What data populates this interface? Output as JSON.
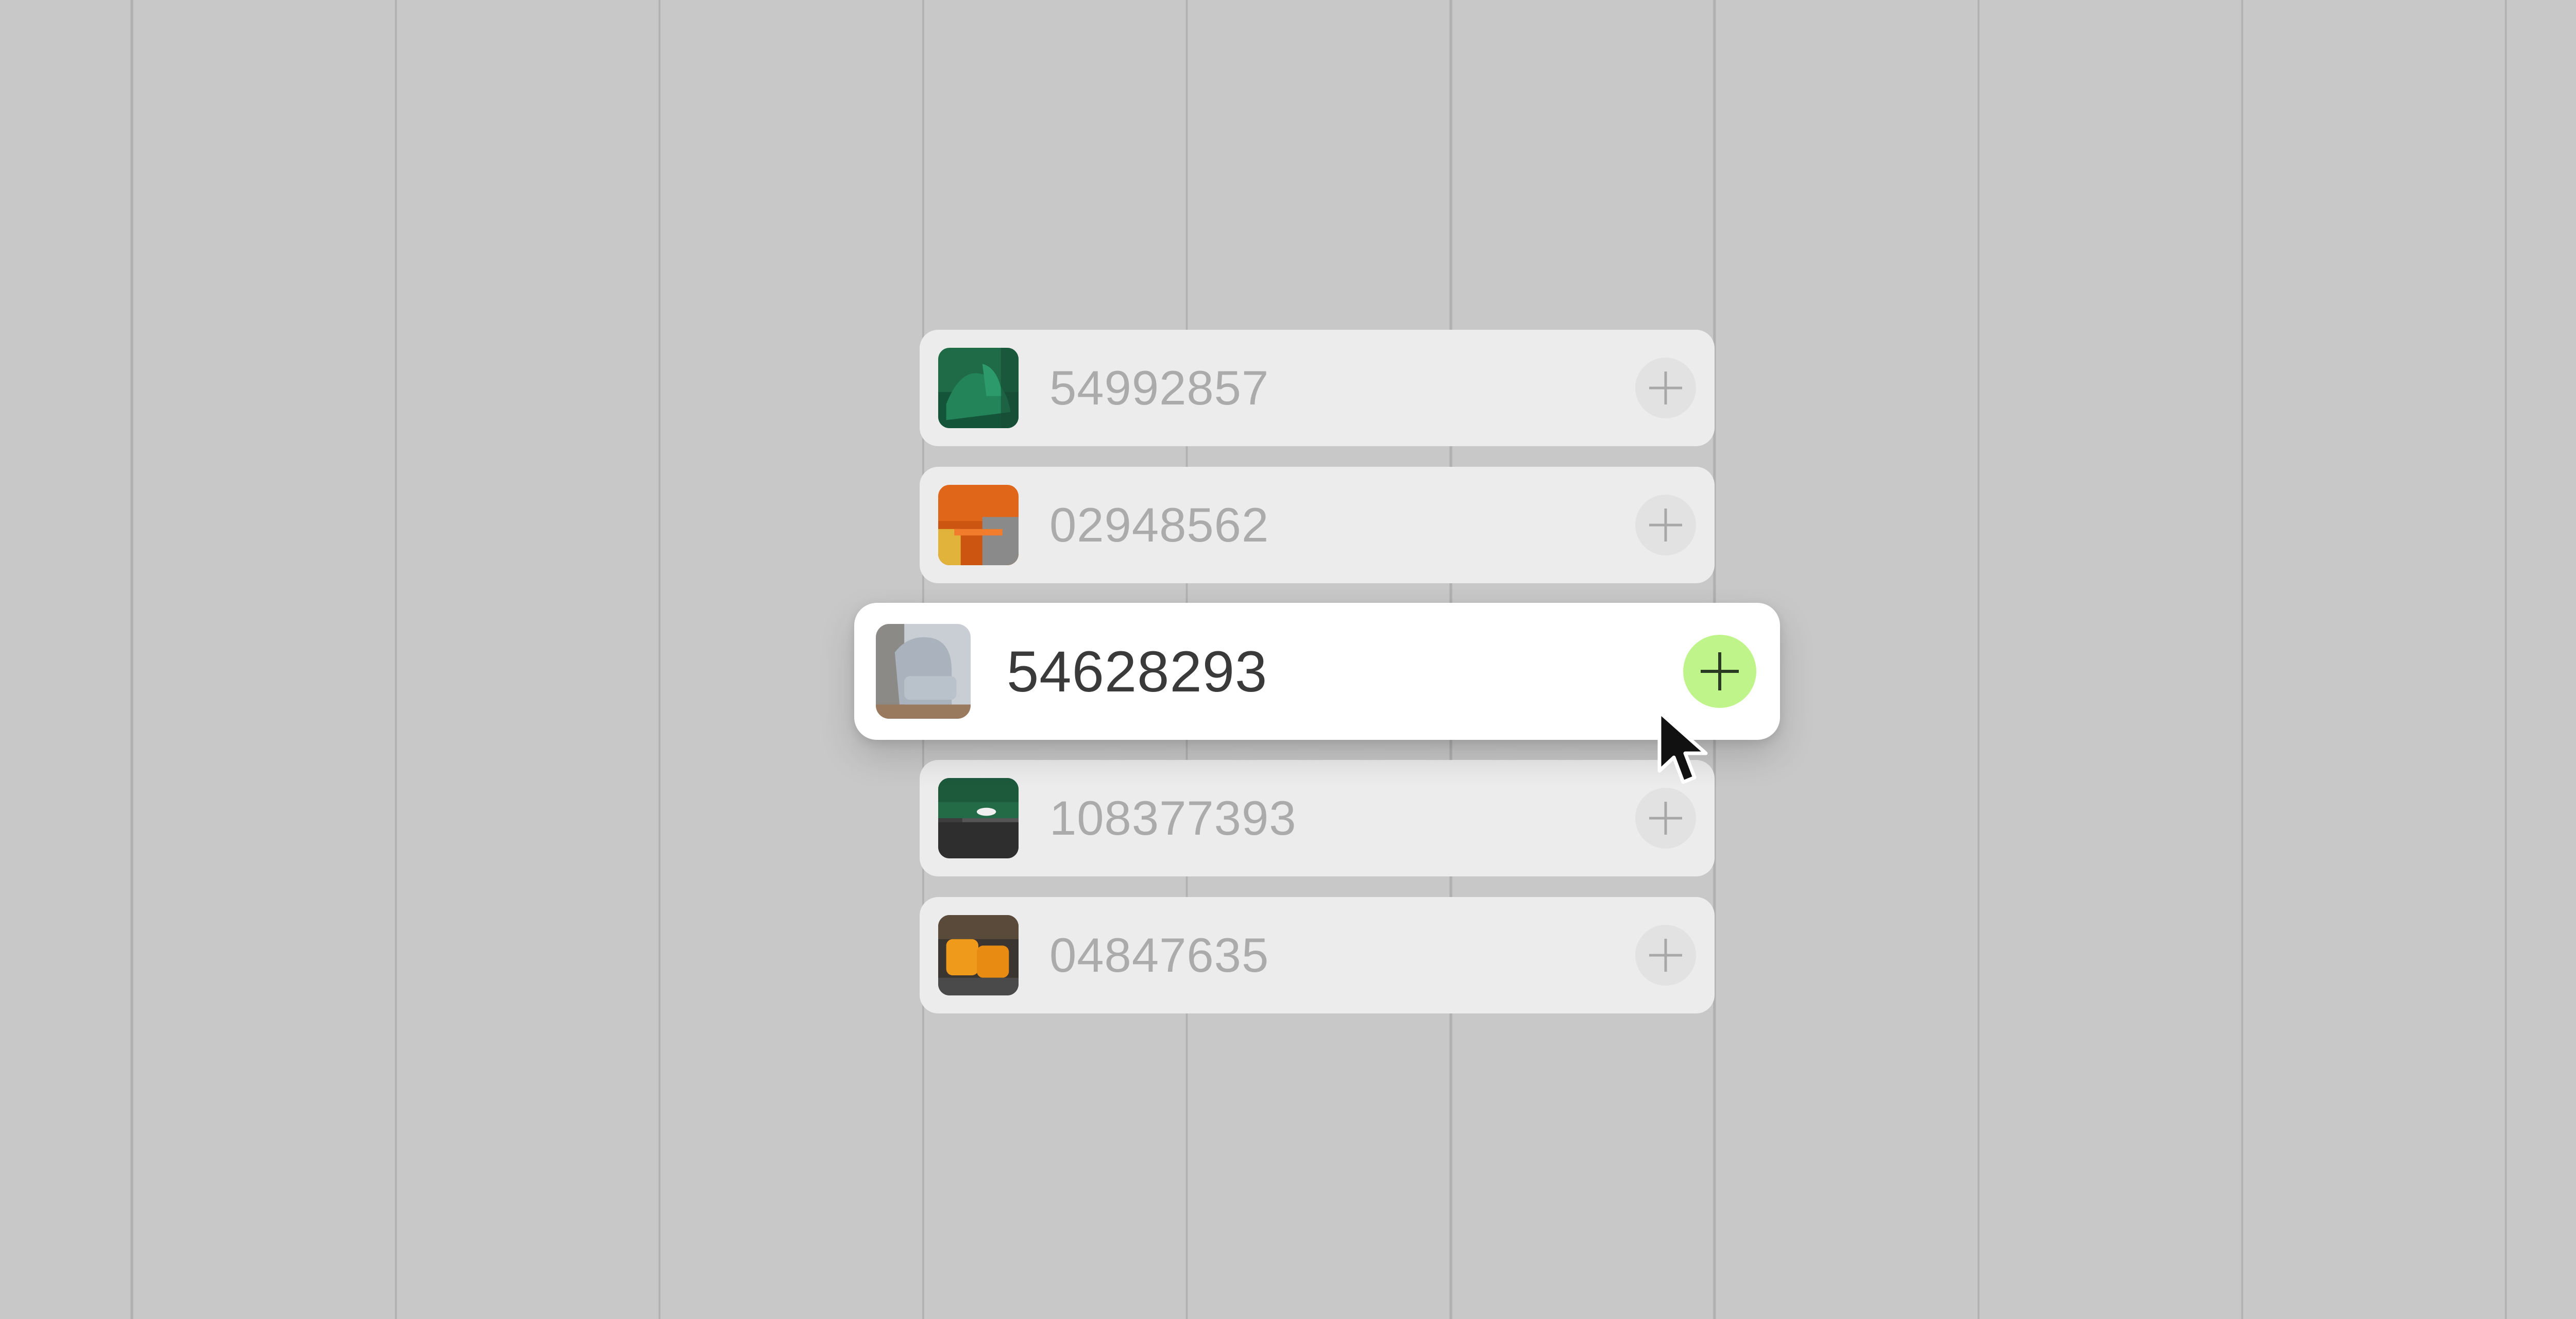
{
  "items": [
    {
      "code": "54992857",
      "thumb": "green-chair-thumbnail",
      "add_icon": "plus-icon",
      "state": "default"
    },
    {
      "code": "02948562",
      "thumb": "orange-cabinet-thumbnail",
      "add_icon": "plus-icon",
      "state": "default"
    },
    {
      "code": "54628293",
      "thumb": "grey-armchair-thumbnail",
      "add_icon": "plus-icon",
      "state": "hovered"
    },
    {
      "code": "108377393",
      "thumb": "green-sofa-thumbnail",
      "add_icon": "plus-icon",
      "state": "default"
    },
    {
      "code": "04847635",
      "thumb": "orange-seat-thumbnail",
      "add_icon": "plus-icon",
      "state": "default"
    }
  ],
  "colors": {
    "background": "#c8c8c8",
    "card": "#ececec",
    "active_card": "#ffffff",
    "add_button": "#e2e2e2",
    "add_button_active": "#bff48a",
    "text_muted": "#ababab",
    "text_active": "#3a3a3a"
  },
  "cursor": "arrow-cursor-icon"
}
